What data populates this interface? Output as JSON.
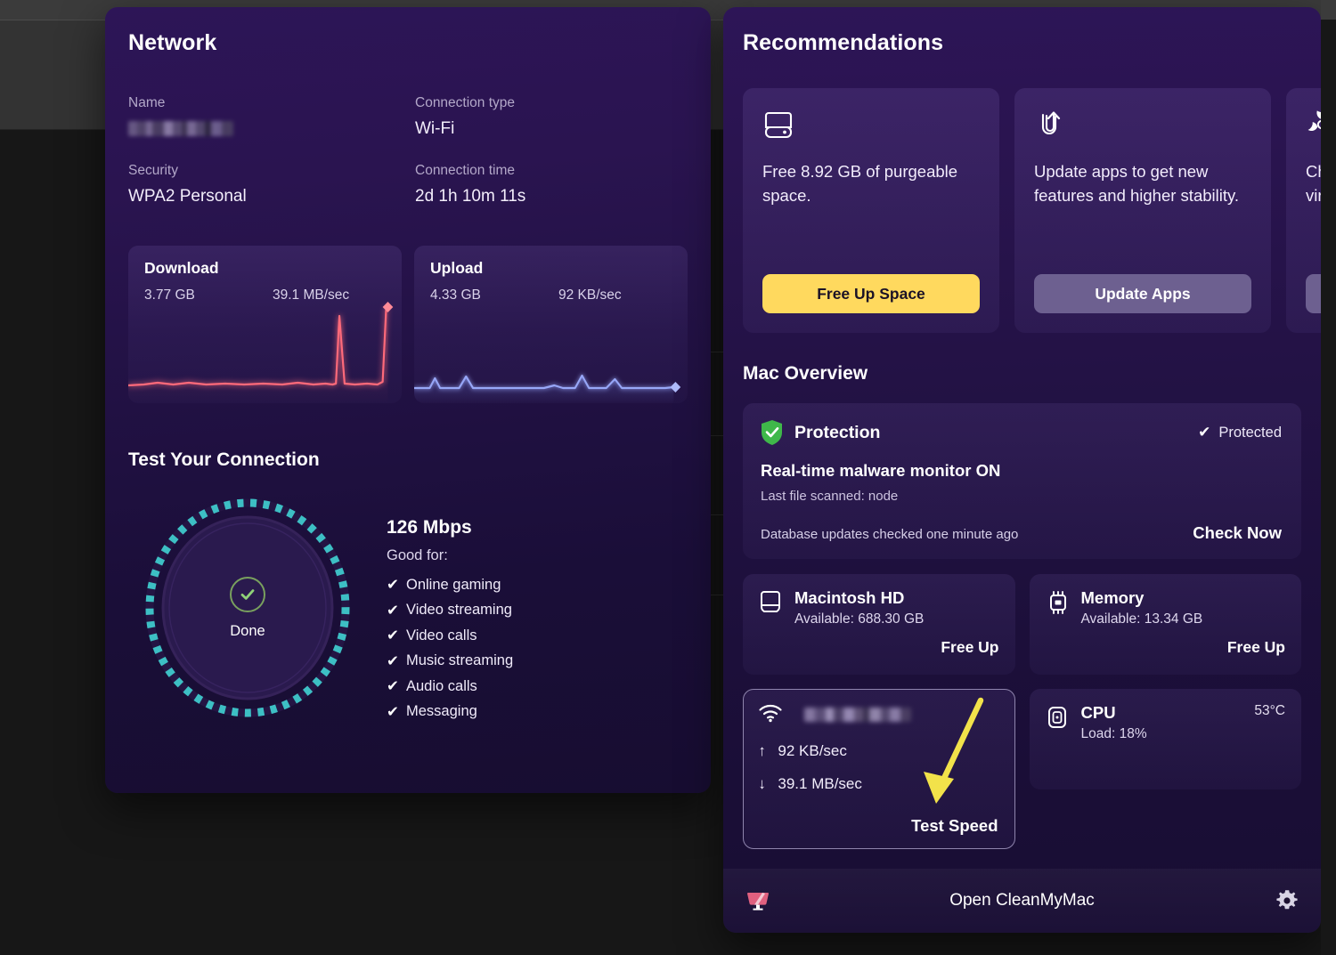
{
  "network": {
    "title": "Network",
    "fields": {
      "name_label": "Name",
      "name_value": "",
      "connection_type_label": "Connection type",
      "connection_type_value": "Wi-Fi",
      "security_label": "Security",
      "security_value": "WPA2 Personal",
      "connection_time_label": "Connection time",
      "connection_time_value": "2d 1h 10m 11s"
    },
    "download": {
      "title": "Download",
      "total": "3.77 GB",
      "rate": "39.1 MB/sec",
      "color": "#ff6b7a"
    },
    "upload": {
      "title": "Upload",
      "total": "4.33 GB",
      "rate": "92 KB/sec",
      "color": "#7b8ff5"
    },
    "test": {
      "section_title": "Test Your Connection",
      "gauge_status": "Done",
      "speed": "126 Mbps",
      "good_for_label": "Good for:",
      "good_for": [
        "Online gaming",
        "Video streaming",
        "Video calls",
        "Music streaming",
        "Audio calls",
        "Messaging"
      ],
      "tick_glyph": "✔",
      "ring_color": "#3dbfc4",
      "check_color": "#8fd178"
    }
  },
  "recommendations": {
    "title": "Recommendations",
    "cards": [
      {
        "icon": "hard-drive-icon",
        "text": "Free 8.92 GB of purgeable space.",
        "button": "Free Up Space",
        "style": "primary"
      },
      {
        "icon": "update-arrow-icon",
        "text": "Update apps to get new features and higher stability.",
        "button": "Update Apps",
        "style": "secondary"
      },
      {
        "icon": "biohazard-icon",
        "text": "Che\nviru",
        "button": "",
        "style": "secondary"
      }
    ]
  },
  "mac_overview": {
    "title": "Mac Overview",
    "protection": {
      "name": "Protection",
      "status": "Protected",
      "status_tick": "✔",
      "line1": "Real-time malware monitor ON",
      "line2": "Last file scanned: node",
      "db_text": "Database updates checked one minute ago",
      "action": "Check Now"
    },
    "disk": {
      "name": "Macintosh HD",
      "sub": "Available: 688.30 GB",
      "action": "Free Up"
    },
    "memory": {
      "name": "Memory",
      "sub": "Available: 13.34 GB",
      "action": "Free Up"
    },
    "cpu": {
      "name": "CPU",
      "sub": "Load: 18%",
      "right": "53°C"
    },
    "wifi": {
      "name": "",
      "upload": "92 KB/sec",
      "download": "39.1 MB/sec",
      "up_arrow": "↑",
      "down_arrow": "↓",
      "action": "Test Speed"
    }
  },
  "footer": {
    "label": "Open CleanMyMac",
    "app_icon": "cleanmymac-icon",
    "settings_icon": "gear-icon"
  },
  "colors": {
    "accent_yellow": "#ffd95e",
    "panel_top": "#2d1557",
    "panel_bottom": "#170d31",
    "annotation": "#f2e24a"
  }
}
